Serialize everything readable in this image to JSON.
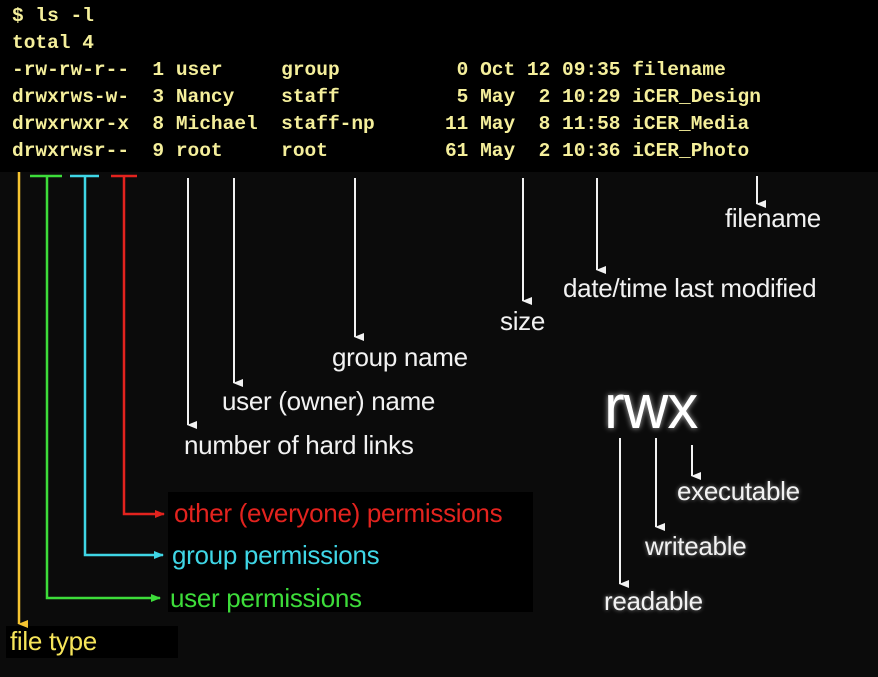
{
  "terminal": {
    "prompt_line": "$ ls -l",
    "total_line": "total 4",
    "rows": [
      {
        "perms": "-rw-rw-r--",
        "links": "1",
        "owner": "user",
        "group": "group",
        "size": "0",
        "month": "Oct",
        "day": "12",
        "time": "09:35",
        "name": "filename"
      },
      {
        "perms": "drwxrws-w-",
        "links": "3",
        "owner": "Nancy",
        "group": "staff",
        "size": "5",
        "month": "May",
        "day": "2",
        "time": "10:29",
        "name": "iCER_Design"
      },
      {
        "perms": "drwxrwxr-x",
        "links": "8",
        "owner": "Michael",
        "group": "staff-np",
        "size": "11",
        "month": "May",
        "day": "8",
        "time": "11:58",
        "name": "iCER_Media"
      },
      {
        "perms": "drwxrwsr--",
        "links": "9",
        "owner": "root",
        "group": "root",
        "size": "61",
        "month": "May",
        "day": "2",
        "time": "10:36",
        "name": "iCER_Photo"
      }
    ]
  },
  "labels": {
    "filename": "filename",
    "date_time": "date/time last modified",
    "size": "size",
    "group_name": "group name",
    "user_name": "user (owner) name",
    "hard_links": "number of hard links",
    "other_perms": "other (everyone) permissions",
    "group_perms": "group permissions",
    "user_perms": "user permissions",
    "file_type": "file type"
  },
  "rwx": {
    "title": "rwx",
    "r": "readable",
    "w": "writeable",
    "x": "executable"
  },
  "colors": {
    "terminal_text": "#f5ef9b",
    "file_type": "#f6c431",
    "user": "#3ddc3a",
    "group": "#3fd6e6",
    "other": "#e3231e",
    "white": "#f2f2f2"
  }
}
